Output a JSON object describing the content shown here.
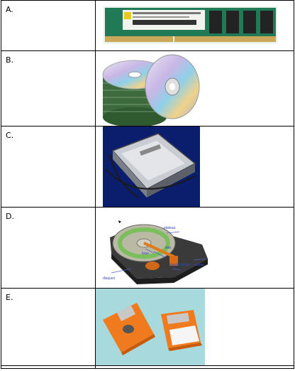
{
  "rows": [
    {
      "label": "A.",
      "picture": "ram-memory-module"
    },
    {
      "label": "B.",
      "picture": "stack-of-cds"
    },
    {
      "label": "C.",
      "picture": "hard-disk-drive"
    },
    {
      "label": "D.",
      "picture": "hard-disk-internal-diagram"
    },
    {
      "label": "E.",
      "picture": "floppy-disks"
    }
  ],
  "diagram_labels": [
    "plateau",
    "tête",
    "bras",
    "platine",
    "disques",
    "bande sonde"
  ],
  "colors": {
    "border": "#000000",
    "ram_pcb": "#1f7a55",
    "cd_stack": "#3d6b3d",
    "hdd_bg": "#0b1e6e",
    "floppy_bg": "#a8d9dc",
    "floppy_orange": "#f07a1e"
  }
}
